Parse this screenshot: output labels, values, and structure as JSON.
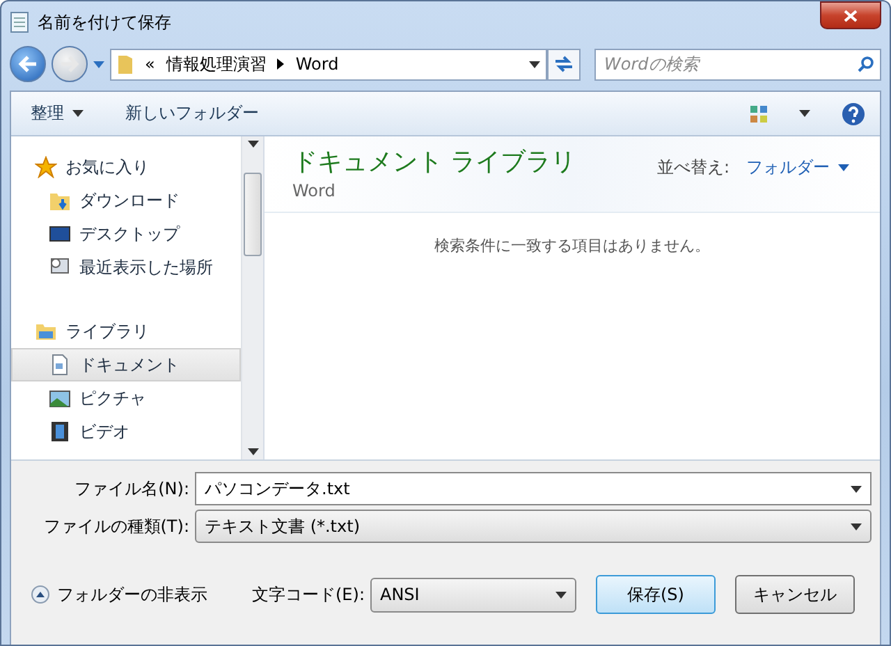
{
  "window": {
    "title": "名前を付けて保存"
  },
  "address": {
    "overflow": "«",
    "path": [
      "情報処理演習",
      "Word"
    ]
  },
  "search": {
    "placeholder": "Wordの検索"
  },
  "toolbar": {
    "organize": "整理",
    "new_folder": "新しいフォルダー"
  },
  "sidebar": {
    "items": [
      {
        "label": "お気に入り",
        "kind": "star",
        "header": true,
        "selected": false
      },
      {
        "label": "ダウンロード",
        "kind": "download",
        "header": false,
        "selected": false
      },
      {
        "label": "デスクトップ",
        "kind": "desktop",
        "header": false,
        "selected": false
      },
      {
        "label": "最近表示した場所",
        "kind": "recent",
        "header": false,
        "selected": false
      },
      {
        "label": "ライブラリ",
        "kind": "library",
        "header": true,
        "selected": false
      },
      {
        "label": "ドキュメント",
        "kind": "document",
        "header": false,
        "selected": true
      },
      {
        "label": "ピクチャ",
        "kind": "picture",
        "header": false,
        "selected": false
      },
      {
        "label": "ビデオ",
        "kind": "video",
        "header": false,
        "selected": false
      }
    ]
  },
  "content": {
    "title": "ドキュメント ライブラリ",
    "subtitle": "Word",
    "sort_label": "並べ替え:",
    "sort_value": "フォルダー",
    "empty_message": "検索条件に一致する項目はありません。"
  },
  "form": {
    "file_name": {
      "label": "ファイル名(N):",
      "value": "パソコンデータ.txt"
    },
    "file_type": {
      "label": "ファイルの種類(T):",
      "value": "テキスト文書 (*.txt)"
    },
    "hide_folders": "フォルダーの非表示",
    "encoding": {
      "label": "文字コード(E):",
      "value": "ANSI"
    },
    "save": "保存(S)",
    "cancel": "キャンセル"
  }
}
